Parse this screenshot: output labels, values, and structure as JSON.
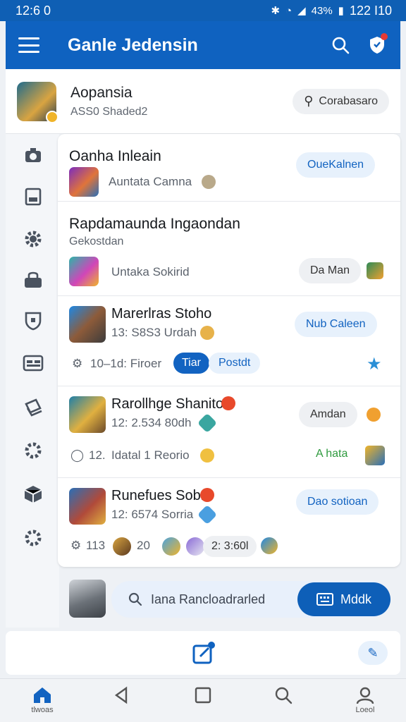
{
  "status": {
    "time": "12:6 0",
    "battery": "43%",
    "clock_right": "122 I10"
  },
  "appbar": {
    "title": "Ganle Jedensin"
  },
  "profile": {
    "name": "Aopansia",
    "subtitle": "ASS0 Shaded2",
    "action_label": "Corabasaro"
  },
  "cards": {
    "c1": {
      "title": "Oanha Inleain",
      "sub": "Auntata Camna",
      "action": "OueKalnen"
    },
    "c2": {
      "title": "Rapdamaunda Ingaondan",
      "sub": "Gekostdan",
      "item": "Untaka Sokirid",
      "action": "Da Man"
    },
    "c3": {
      "title": "Marerlras Stoho",
      "sub": "13: S8S3 Urdah",
      "action": "Nub Caleen",
      "stat": "10–1d: Firoer",
      "tag1": "Tiar",
      "tag2": "Postdt"
    },
    "c4": {
      "title": "Rarollhge Shanito",
      "sub": "12: 2.534 80dh",
      "action": "Amdan",
      "stat": "12.",
      "stat2": "Idatal 1 Reorio",
      "action2": "A hata"
    },
    "c5": {
      "title": "Runefues Sobr",
      "sub": "12: 6574 Sorria",
      "action": "Dao sotioan",
      "stat": "113",
      "stat2": "20",
      "stat3": "2: 3:60l"
    }
  },
  "search": {
    "placeholder": "Iana Rancloadrarled",
    "button_label": "Mddk"
  },
  "nav": {
    "home_label": "tlwoas",
    "profile_label": "Loeol"
  },
  "icons": [
    "menu-icon",
    "search-icon",
    "shield-icon",
    "gear-icon",
    "calendar-icon",
    "home-icon",
    "back-icon",
    "square-icon",
    "user-icon"
  ]
}
